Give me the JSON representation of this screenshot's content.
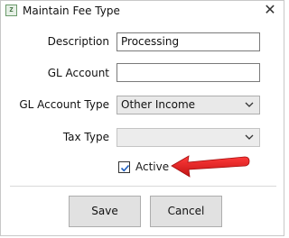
{
  "window": {
    "title": "Maintain Fee Type",
    "icon": "app-icon",
    "icon_glyph": "Z",
    "close_glyph": "✕"
  },
  "form": {
    "description": {
      "label": "Description",
      "value": "Processing"
    },
    "gl_account": {
      "label": "GL Account",
      "value": ""
    },
    "gl_account_type": {
      "label": "GL Account Type",
      "selected": "Other Income"
    },
    "tax_type": {
      "label": "Tax Type",
      "selected": ""
    },
    "active": {
      "label": "Active",
      "checked": true
    }
  },
  "annotation": {
    "color": "#e31b1b"
  },
  "buttons": {
    "save": "Save",
    "cancel": "Cancel"
  }
}
